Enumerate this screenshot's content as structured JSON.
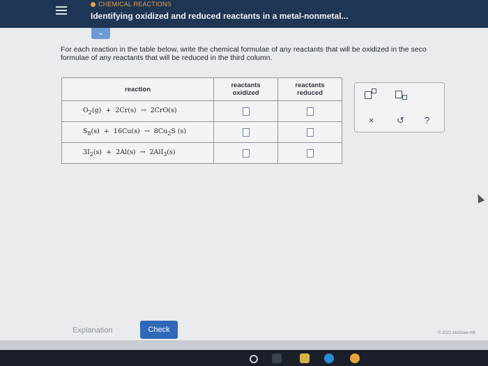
{
  "header": {
    "topic": "CHEMICAL REACTIONS",
    "title": "Identifying oxidized and reduced reactants in a metal-nonmetal..."
  },
  "instructions": {
    "line1": "For each reaction in the table below, write the chemical formulae of any reactants that will be oxidized in the seco",
    "line2": "formulae of any reactants that will be reduced in the third column."
  },
  "table": {
    "headers": {
      "reaction": "reaction",
      "oxidized_1": "reactants",
      "oxidized_2": "oxidized",
      "reduced_1": "reactants",
      "reduced_2": "reduced"
    },
    "rows": [
      {
        "r1": "O",
        "r1sub": "2",
        "r1st": "(g)",
        "plus": "+",
        "r2": "2Cr",
        "r2st": "(s)",
        "arrow": "→",
        "p": "2CrO",
        "pst": "(s)"
      },
      {
        "r1": "S",
        "r1sub": "8",
        "r1st": "(s)",
        "plus": "+",
        "r2": "16Cu",
        "r2st": "(s)",
        "arrow": "→",
        "p": "8Cu",
        "psub": "2",
        "pS": "S",
        "pst": "(s)"
      },
      {
        "r1": "3I",
        "r1sub": "2",
        "r1st": "(s)",
        "plus": "+",
        "r2": "2Al",
        "r2st": "(s)",
        "arrow": "→",
        "p": "2AlI",
        "psub": "3",
        "pst": "(s)"
      }
    ]
  },
  "palette": {
    "clear": "×",
    "undo": "↺",
    "help": "?"
  },
  "footer": {
    "explanation": "Explanation",
    "check": "Check",
    "copyright": "© 2021 McGraw-Hill"
  },
  "colors": {
    "header_bg": "#1f3554",
    "topic": "#e4a24a",
    "check_button": "#2f69b8"
  }
}
